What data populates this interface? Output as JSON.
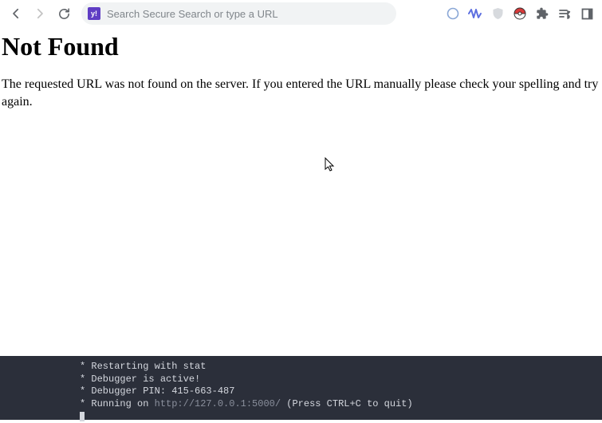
{
  "toolbar": {
    "omnibox_favicon": "y!",
    "omnibox_placeholder": "Search Secure Search or type a URL"
  },
  "page": {
    "heading": "Not Found",
    "body": "The requested URL was not found on the server. If you entered the URL manually please check your spelling and try again."
  },
  "terminal": {
    "line1": " * Restarting with stat",
    "line2": " * Debugger is active!",
    "line3": " * Debugger PIN: 415-663-487",
    "line4a": " * Running on ",
    "line4_url": "http://127.0.0.1:5000/",
    "line4b": " (Press CTRL+C to quit)"
  }
}
